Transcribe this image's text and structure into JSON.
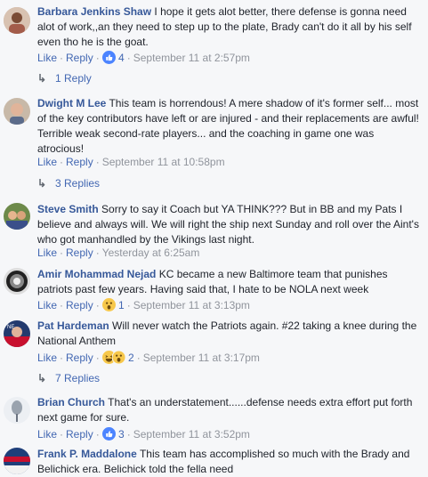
{
  "actions": {
    "like": "Like",
    "reply": "Reply",
    "dot": "·"
  },
  "comments": [
    {
      "name": "Barbara Jenkins Shaw",
      "text": "I hope it gets alot better, there defense is gonna need alot of work,,an they need to step up to the plate, Brady can't do it all by his self even tho he is the goat.",
      "reactions": "4",
      "time": "September 11 at 2:57pm",
      "replies": "1 Reply"
    },
    {
      "name": "Dwight M Lee",
      "text": "This team is horrendous! A mere shadow of it's former self... most of the key contributors have left or are injured - and their replacements are awful! Terrible weak second-rate players... and the coaching in game one was atrocious!",
      "time": "September 11 at 10:58pm",
      "replies": "3 Replies"
    },
    {
      "name": "Steve Smith",
      "text": "Sorry to say it Coach but YA THINK??? But in BB and my Pats I believe and always will. We will right the ship next Sunday and roll over the Aint's who got manhandled by the Vikings last night.",
      "time": "Yesterday at 6:25am"
    },
    {
      "name": "Amir Mohammad Nejad",
      "text": "KC became a new Baltimore team that punishes patriots past few years. Having said that, I hate to be NOLA next week",
      "reactions": "1",
      "time": "September 11 at 3:13pm"
    },
    {
      "name": "Pat Hardeman",
      "text": "Will never watch the Patriots again. #22 taking a knee during the National Anthem",
      "reactions": "2",
      "time": "September 11 at 3:17pm",
      "replies": "7 Replies"
    },
    {
      "name": "Brian Church",
      "text": "That's an understatement......defense needs extra effort put forth next game for sure.",
      "reactions": "3",
      "time": "September 11 at 3:52pm"
    },
    {
      "name": "Frank P. Maddalone",
      "text": "This team has accomplished so much with the Brady and Belichick era. Belichick told the fella need"
    }
  ],
  "icons": {
    "like": "like-icon",
    "wow": "wow-icon",
    "haha": "haha-icon",
    "reply_arrow": "reply-arrow-icon"
  }
}
